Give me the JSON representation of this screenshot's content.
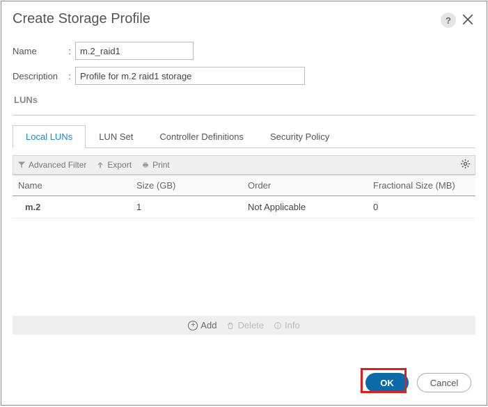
{
  "dialog": {
    "title": "Create Storage Profile"
  },
  "form": {
    "name_label": "Name",
    "name_value": "m.2_raid1",
    "desc_label": "Description",
    "desc_value": "Profile for m.2 raid1 storage",
    "section_label": "LUNs"
  },
  "tabs": {
    "local_luns": "Local LUNs",
    "lun_set": "LUN Set",
    "controller_defs": "Controller Definitions",
    "security_policy": "Security Policy"
  },
  "toolbar": {
    "adv_filter": "Advanced Filter",
    "export": "Export",
    "print": "Print"
  },
  "columns": {
    "name": "Name",
    "size": "Size (GB)",
    "order": "Order",
    "frac": "Fractional Size (MB)"
  },
  "rows": [
    {
      "name": "m.2",
      "size": "1",
      "order": "Not Applicable",
      "frac": "0"
    }
  ],
  "footer": {
    "add": "Add",
    "delete": "Delete",
    "info": "Info"
  },
  "buttons": {
    "ok": "OK",
    "cancel": "Cancel"
  }
}
